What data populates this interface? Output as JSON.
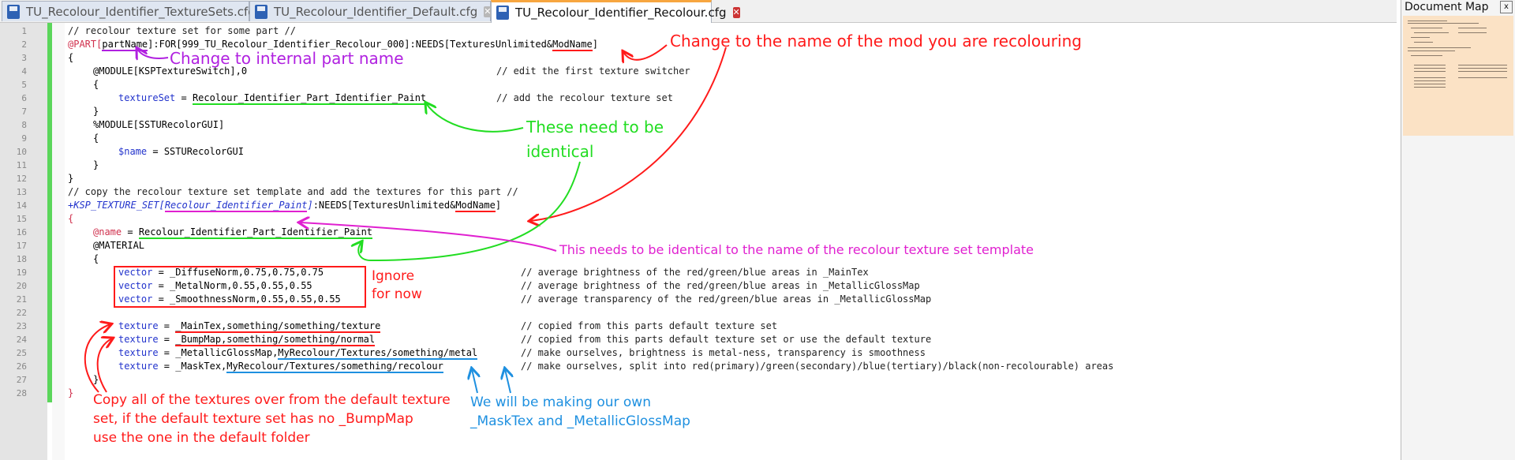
{
  "tabs": [
    {
      "label": "TU_Recolour_Identifier_TextureSets.cfg",
      "active": false
    },
    {
      "label": "TU_Recolour_Identifier_Default.cfg",
      "active": false
    },
    {
      "label": "TU_Recolour_Identifier_Recolour.cfg",
      "active": true
    }
  ],
  "doc_map": {
    "title": "Document Map",
    "close": "x"
  },
  "line_numbers": [
    "1",
    "2",
    "3",
    "4",
    "5",
    "6",
    "7",
    "8",
    "9",
    "10",
    "11",
    "12",
    "13",
    "14",
    "15",
    "16",
    "17",
    "18",
    "19",
    "20",
    "21",
    "22",
    "23",
    "24",
    "25",
    "26",
    "27",
    "28"
  ],
  "code": {
    "l1": "// recolour texture set for some part //",
    "l2a": "@PART[",
    "l2b": "partName",
    "l2c": "]:FOR[999_TU_Recolour_Identifier_Recolour_000]:NEEDS[TexturesUnlimited&",
    "l2d": "ModName",
    "l2e": "]",
    "l3": "{",
    "l4a": "@MODULE[KSPTextureSwitch],0",
    "l4b": "// edit the first texture switcher",
    "l5": "{",
    "l6a": "textureSet",
    "l6b": " = ",
    "l6c": "Recolour_Identifier_Part_Identifier_Paint",
    "l6d": "// add the recolour texture set",
    "l7": "}",
    "l8": "%MODULE[SSTURecolorGUI]",
    "l9": "{",
    "l10a": "$name",
    "l10b": " = ",
    "l10c": "SSTURecolorGUI",
    "l11": "}",
    "l12": "}",
    "l13": "// copy the recolour texture set template and add the textures for this part //",
    "l14a": "+KSP_TEXTURE_SET[",
    "l14b": "Recolour_Identifier_Paint",
    "l14c": "]",
    "l14d": ":NEEDS[TexturesUnlimited&",
    "l14e": "ModName",
    "l14f": "]",
    "l15": "{",
    "l16a": "@name",
    "l16b": " = ",
    "l16c": "Recolour_Identifier_Part_Identifier_Paint",
    "l17": "@MATERIAL",
    "l18": "{",
    "l19a": "vector",
    "l19b": " = _DiffuseNorm,0.75,0.75,0.75",
    "l19c": "// average brightness of the red/green/blue areas in _MainTex",
    "l20a": "vector",
    "l20b": " = _MetalNorm,0.55,0.55,0.55",
    "l20c": "// average brightness of the red/green/blue areas in _MetallicGlossMap",
    "l21a": "vector",
    "l21b": " = _SmoothnessNorm,0.55,0.55,0.55",
    "l21c": "// average transparency of the red/green/blue areas in _MetallicGlossMap",
    "l23a": "texture",
    "l23b": " = ",
    "l23c": "_MainTex,something/something/texture",
    "l23d": "// copied from this parts default texture set",
    "l24a": "texture",
    "l24b": " = ",
    "l24c": "_BumpMap,something/something/normal",
    "l24d": "// copied from this parts default texture set or use the default texture",
    "l25a": "texture",
    "l25b": " = _MetallicGlossMap,",
    "l25c": "MyRecolour/Textures/something/metal",
    "l25d": "// make ourselves, brightness is metal-ness, transparency is smoothness",
    "l26a": "texture",
    "l26b": " = _MaskTex,",
    "l26c": "MyRecolour/Textures/something/recolour",
    "l26d": "// make ourselves, split into red(primary)/green(secondary)/blue(tertiary)/black(non-recolourable) areas",
    "l27": "}",
    "l28": "}"
  },
  "annotations": {
    "modname": "Change to the name of the mod you are recolouring",
    "partname": "Change to internal part name",
    "identical_1": "These need to be",
    "identical_2": "identical",
    "template": "This needs to be identical to the name of the recolour texture set template",
    "ignore_1": "Ignore",
    "ignore_2": "for now",
    "copy_1": "Copy all of the textures over from the default texture",
    "copy_2": "set, if the default texture set has no _BumpMap",
    "copy_3": "use the one in the default folder",
    "own_1": "We will be making our own",
    "own_2": "_MaskTex and _MetallicGlossMap"
  },
  "colors": {
    "red": "#ff1a1a",
    "magenta": "#e020d0",
    "purple": "#b020e0",
    "green": "#22dd22",
    "blue": "#1e90e0",
    "keyword_blue": "#2233cc",
    "at_red": "#d0304d",
    "accent_orange": "#f7a640"
  }
}
